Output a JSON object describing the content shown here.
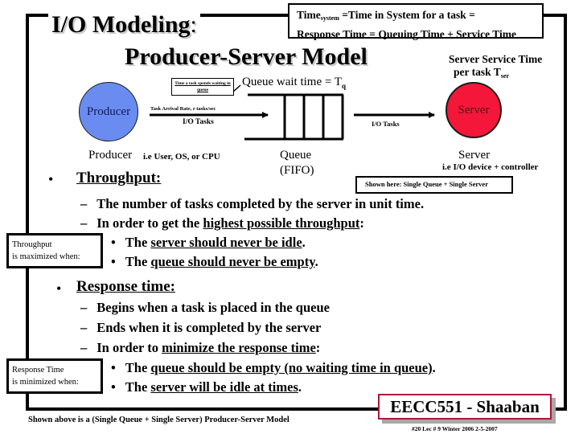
{
  "title": {
    "line1": "I/O Modeling",
    "line1_suffix": ":",
    "line2": "Producer-Server Model"
  },
  "time_box": {
    "line1_prefix": "Time",
    "line1_sub": "system",
    "line1_rest": " =Time in System for a task =",
    "line2": "Response Time =  Queuing Time + Service Time"
  },
  "service_time": {
    "line1": "Server Service Time",
    "line2_prefix": "per task  T",
    "line2_sub": "ser"
  },
  "diagram": {
    "queue_callout": "Time a task spends waiting in queue",
    "queue_wait_prefix": "Queue wait time  =  T",
    "queue_wait_sub": "q",
    "producer_circle": "Producer",
    "server_circle": "Server",
    "arrival_rate": "Task Arrival Rate, r tasks/sec",
    "io_tasks_in": "I/O  Tasks",
    "io_tasks_out": "I/O Tasks",
    "producer_label": "Producer",
    "producer_examples": "i.e User, OS, or CPU",
    "queue_label_line1": "Queue",
    "queue_label_line2": "(FIFO)",
    "server_label": "Server",
    "server_examples": "i.e I/O device + controller",
    "shown_here": "Shown here:  Single Queue + Single Server",
    "colors": {
      "producer": "#6a8cf0",
      "server": "#f5173a"
    }
  },
  "throughput": {
    "heading": "Throughput:",
    "dash1": "The number of tasks completed by the server in unit time.",
    "dash2_prefix": "In order to get the ",
    "dash2_underlined": "highest possible throughput",
    "dash2_suffix": ":",
    "bullet1_prefix": "The ",
    "bullet1_underlined": "server should never be idle",
    "bullet1_suffix": ".",
    "bullet2_prefix": "The ",
    "bullet2_underlined": "queue should never be empty",
    "bullet2_suffix": ".",
    "side_box_line1": "Throughput",
    "side_box_line2": " is maximized when:"
  },
  "response_time": {
    "heading": "Response time:",
    "dash1": "Begins when a task is placed in the queue",
    "dash2": "Ends when it is completed by the server",
    "dash3_prefix": "In order to ",
    "dash3_underlined": "minimize the response time",
    "dash3_suffix": ":",
    "bullet1_prefix": "The ",
    "bullet1_underlined": "queue should be empty (no waiting time in queue)",
    "bullet1_suffix": ".",
    "bullet2_prefix": "The ",
    "bullet2_underlined": "server will be idle at times",
    "bullet2_suffix": ".",
    "side_box_line1": "Response Time",
    "side_box_line2": " is minimized when:"
  },
  "footer": {
    "caption": "Shown above is a (Single Queue + Single Server) Producer-Server Model",
    "brand": "EECC551 - Shaaban",
    "slide_info": "#20   Lec # 9   Winter 2006  2-5-2007",
    "brand_border_color": "#b0163a"
  },
  "glyphs": {
    "bullet": "•",
    "dash": "–"
  }
}
